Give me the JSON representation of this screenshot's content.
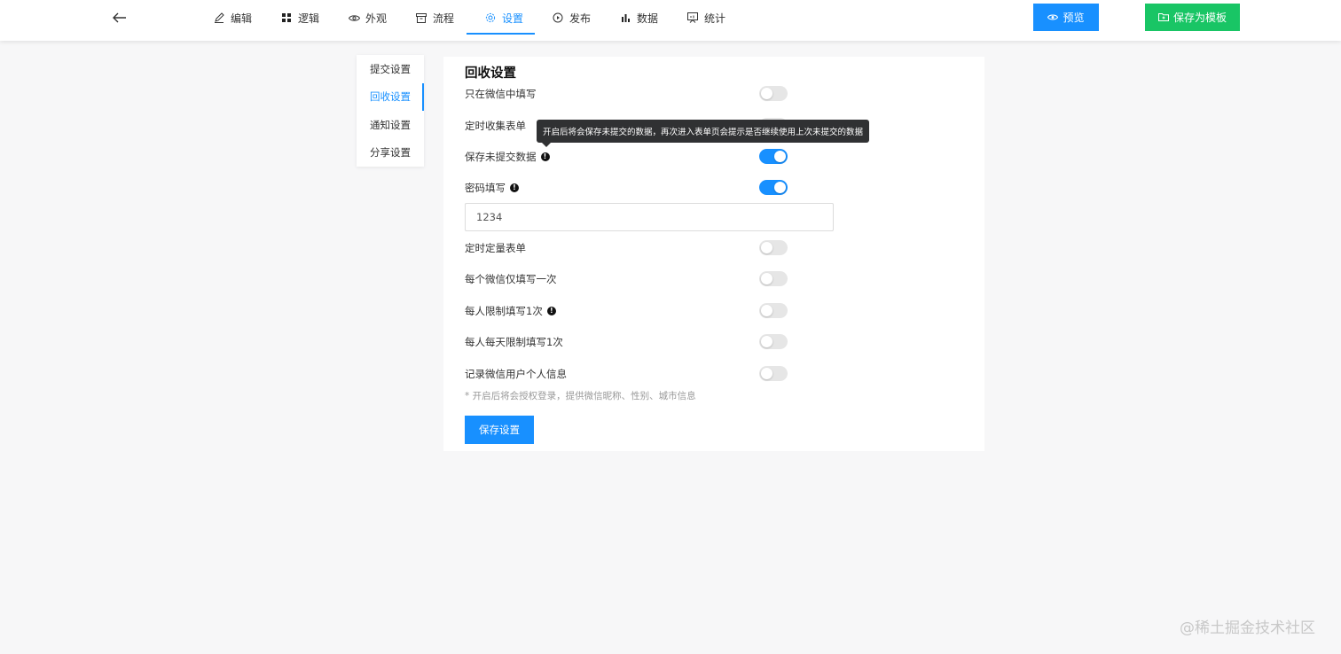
{
  "nav": {
    "tabs": [
      {
        "label": "编辑",
        "icon": "edit-icon"
      },
      {
        "label": "逻辑",
        "icon": "grid-icon"
      },
      {
        "label": "外观",
        "icon": "eye-icon"
      },
      {
        "label": "流程",
        "icon": "archive-icon"
      },
      {
        "label": "设置",
        "icon": "gear-icon",
        "active": true
      },
      {
        "label": "发布",
        "icon": "play-circle-icon"
      },
      {
        "label": "数据",
        "icon": "bar-chart-icon"
      },
      {
        "label": "统计",
        "icon": "report-icon"
      }
    ],
    "preview_label": "预览",
    "save_template_label": "保存为模板"
  },
  "sidemenu": {
    "items": [
      {
        "label": "提交设置"
      },
      {
        "label": "回收设置",
        "active": true
      },
      {
        "label": "通知设置"
      },
      {
        "label": "分享设置"
      }
    ]
  },
  "panel": {
    "title": "回收设置",
    "rows": [
      {
        "label": "只在微信中填写",
        "enabled": false
      },
      {
        "label": "定时收集表单",
        "enabled": false
      },
      {
        "label": "保存未提交数据",
        "enabled": true
      },
      {
        "label": "密码填写",
        "enabled": true
      },
      {
        "label": "定时定量表单",
        "enabled": false
      },
      {
        "label": "每个微信仅填写一次",
        "enabled": false
      },
      {
        "label": "每人限制填写1次",
        "enabled": false
      },
      {
        "label": "每人每天限制填写1次",
        "enabled": false
      },
      {
        "label": "记录微信用户个人信息",
        "enabled": false
      }
    ],
    "password_value": "1234",
    "hint": "* 开启后将会授权登录，提供微信昵称、性别、城市信息",
    "save_label": "保存设置"
  },
  "tooltip": "开启后将会保存未提交的数据，再次进入表单页会提示是否继续使用上次未提交的数据",
  "watermark": "@稀土掘金技术社区",
  "colors": {
    "accent": "#1890ff",
    "success": "#19c565"
  }
}
